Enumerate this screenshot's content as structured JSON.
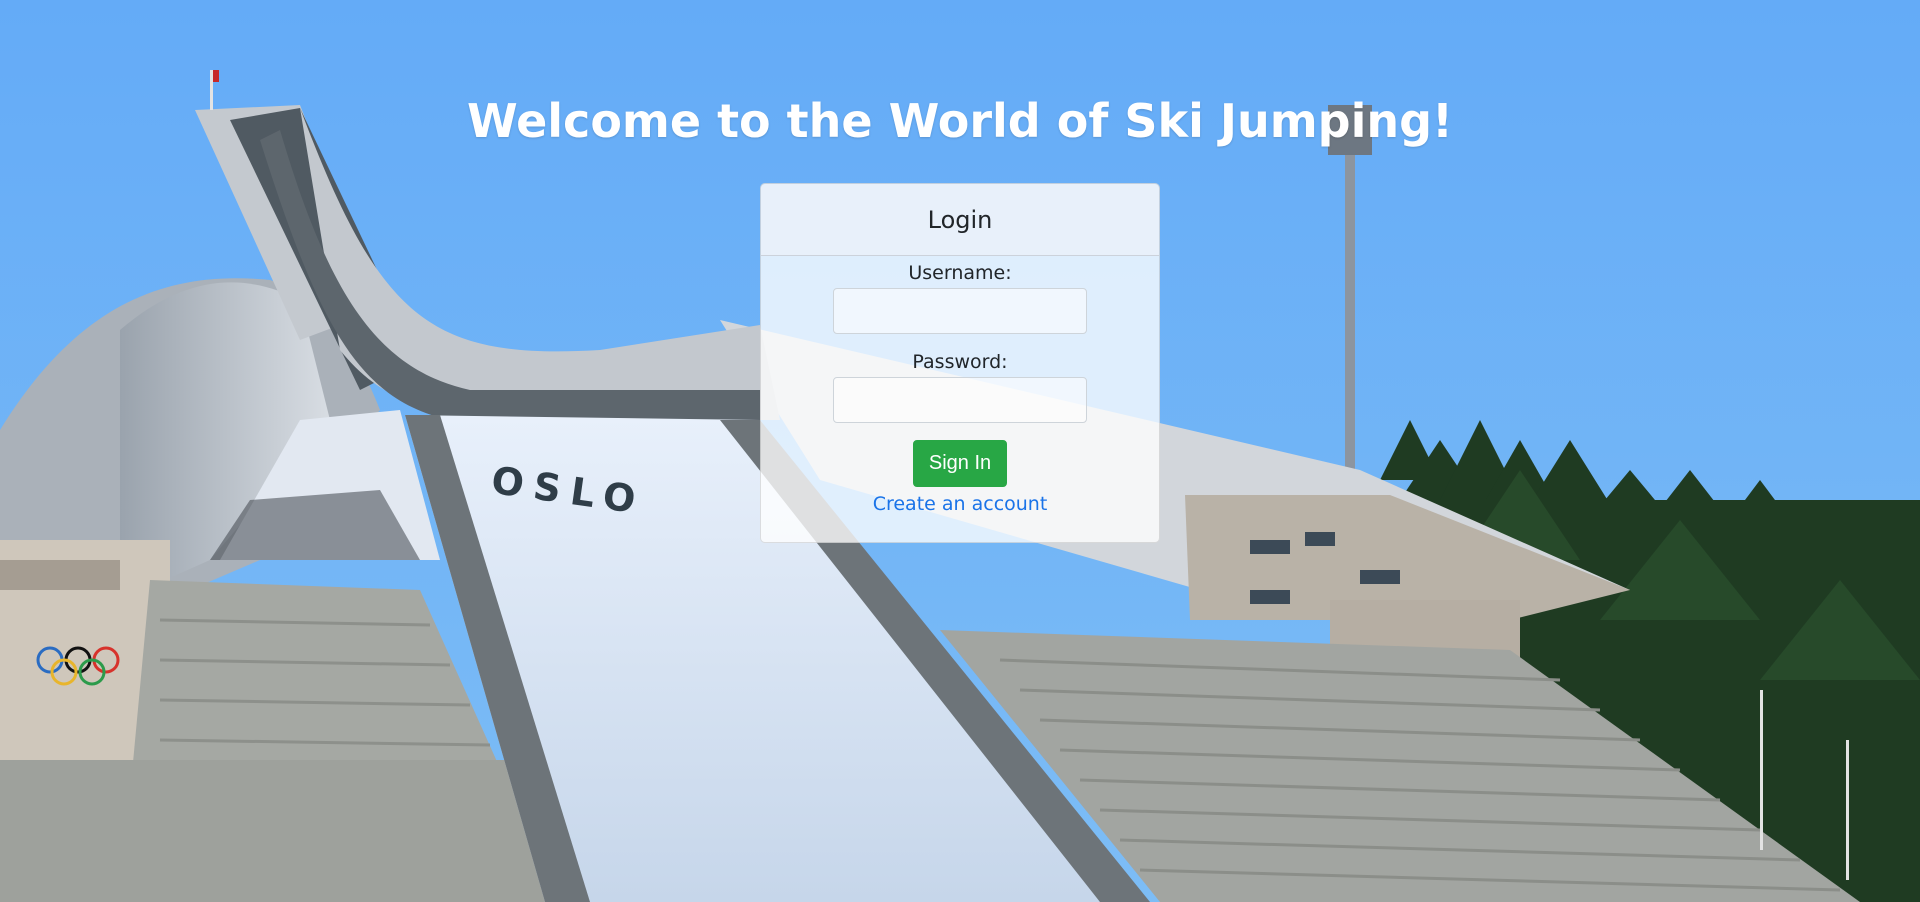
{
  "page": {
    "heading": "Welcome to the World of Ski Jumping!"
  },
  "background": {
    "description_visible_text": "OSLO",
    "sky_color": "#66aef5"
  },
  "login_card": {
    "title": "Login",
    "username_label": "Username:",
    "username_value": "",
    "password_label": "Password:",
    "password_value": "",
    "sign_in_label": "Sign In",
    "create_account_label": "Create an account",
    "sign_in_color": "#28a745",
    "link_color": "#1a73e8"
  }
}
